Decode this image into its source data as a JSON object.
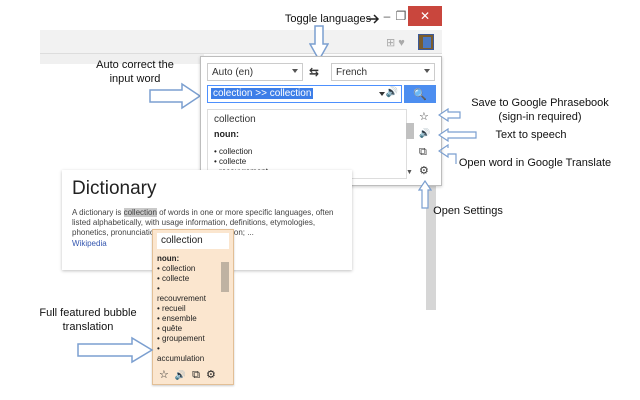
{
  "annotations": {
    "toggle_languages": "Toggle languages",
    "auto_correct": "Auto correct the\ninput word",
    "save_phrasebook": "Save to Google Phrasebook\n(sign-in required)",
    "text_to_speech": "Text to speech",
    "open_in_translate": "Open word in Google Translate",
    "open_settings": "Open Settings",
    "bubble_translation": "Full featured bubble\ntranslation"
  },
  "window": {
    "minimize": "–",
    "restore": "❐",
    "close": "✕"
  },
  "popup": {
    "source_language": "Auto (en)",
    "swap_icon": "⇆",
    "target_language": "French",
    "input_corrected": "colection >> collection",
    "speaker_icon": "🔊",
    "search_icon": "🔍",
    "result_word": "collection",
    "part_of_speech": "noun:",
    "meanings": [
      "• collection",
      "• collecte",
      "• recouvrement"
    ],
    "side_icons": {
      "star": "☆",
      "speaker": "🔊",
      "open": "⧉",
      "gear": "⚙"
    }
  },
  "dictionary": {
    "title": "Dictionary",
    "text_before": "A dictionary is ",
    "text_highlight": "collection",
    "text_after": " of words in one or more specific languages, often listed alphabetically, with usage information, definitions, etymologies, phonetics, pronunciations, and other information; ...",
    "source": "Wikipedia"
  },
  "bubble": {
    "word": "collection",
    "part_of_speech": "noun:",
    "meanings": [
      "• collection",
      "• collecte",
      "•",
      "recouvrement",
      "• recueil",
      "• ensemble",
      "• quête",
      "• groupement",
      "•",
      "accumulation"
    ],
    "icons": {
      "star": "☆",
      "speaker": "🔊",
      "open": "⧉",
      "gear": "⚙"
    }
  },
  "colors": {
    "primary_blue": "#4d8ef0",
    "close_red": "#c9463d",
    "bubble_bg": "#fbe6cf",
    "arrow_blue": "#7b9fd0"
  }
}
